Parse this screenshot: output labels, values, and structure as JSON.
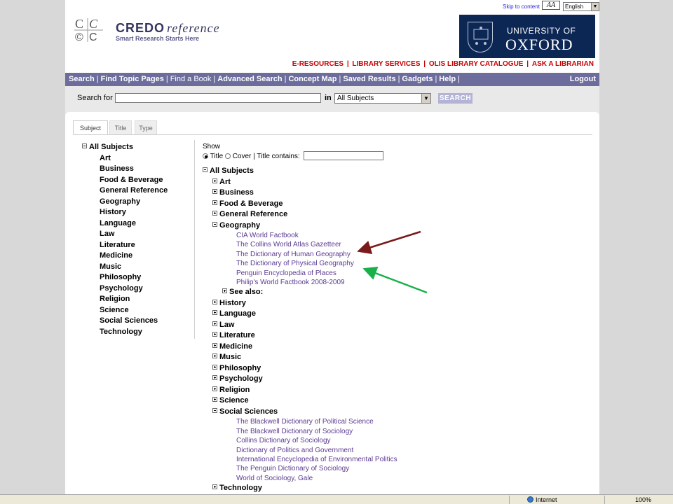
{
  "header": {
    "skip_link": "Skip to content",
    "text_size_icon": "AA",
    "language": "English",
    "credo_brand": "CREDO",
    "credo_brand_suffix": "reference",
    "tagline": "Smart Research Starts Here",
    "oxford_line1": "UNIVERSITY OF",
    "oxford_line2": "OXFORD",
    "top_links": [
      "E-RESOURCES",
      "LIBRARY SERVICES",
      "OLIS LIBRARY CATALOGUE",
      "ASK A LIBRARIAN"
    ],
    "top_link_color": "#c60000"
  },
  "nav": {
    "items": [
      "Search",
      "Find Topic Pages",
      "Find a Book",
      "Advanced Search",
      "Concept Map",
      "Saved Results",
      "Gadgets",
      "Help"
    ],
    "logout": "Logout",
    "bar_color": "#6d6d9d"
  },
  "search": {
    "label": "Search for",
    "in_label": "in",
    "subject_value": "All Subjects",
    "button": "SEARCH"
  },
  "tabs": [
    "Subject",
    "Title",
    "Type"
  ],
  "sidebar": {
    "root": "All Subjects",
    "items": [
      "Art",
      "Business",
      "Food & Beverage",
      "General Reference",
      "Geography",
      "History",
      "Language",
      "Law",
      "Literature",
      "Medicine",
      "Music",
      "Philosophy",
      "Psychology",
      "Religion",
      "Science",
      "Social Sciences",
      "Technology"
    ]
  },
  "show": {
    "label": "Show",
    "option_title": "Title",
    "option_cover": "Cover",
    "title_contains": "Title contains:"
  },
  "tree": {
    "root": "All Subjects",
    "see_also": "See also:",
    "subjects_before_geography": [
      "Art",
      "Business",
      "Food & Beverage",
      "General Reference"
    ],
    "geography": "Geography",
    "geography_books": [
      "CIA World Factbook",
      "The Collins World Atlas Gazetteer",
      "The Dictionary of Human Geography",
      "The Dictionary of Physical Geography",
      "Penguin Encyclopedia of Places",
      "Philip's World Factbook 2008-2009"
    ],
    "subjects_middle": [
      "History",
      "Language",
      "Law",
      "Literature",
      "Medicine",
      "Music",
      "Philosophy",
      "Psychology",
      "Religion",
      "Science"
    ],
    "social_sciences": "Social Sciences",
    "social_sciences_books": [
      "The Blackwell Dictionary of Political Science",
      "The Blackwell Dictionary of Sociology",
      "Collins Dictionary of Sociology",
      "Dictionary of Politics and Government",
      "International Encyclopedia of Environmental Politics",
      "The Penguin Dictionary of Sociology",
      "World of Sociology, Gale"
    ],
    "technology": "Technology",
    "link_color": "#5c3b91"
  },
  "annotations": {
    "arrow_red_color": "#7a1a1a",
    "arrow_green_color": "#19b04a"
  },
  "statusbar": {
    "zone": "Internet",
    "zoom": "100%"
  }
}
